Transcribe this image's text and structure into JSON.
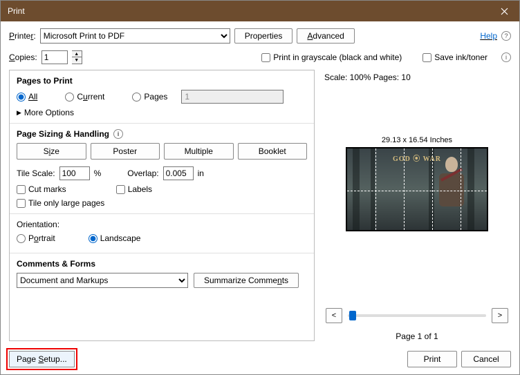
{
  "title": "Print",
  "printer": {
    "label": "Printer:",
    "selected": "Microsoft Print to PDF"
  },
  "buttons": {
    "properties": "Properties",
    "advanced": "Advanced",
    "summarize": "Summarize Comments",
    "page_setup": "Page Setup...",
    "print": "Print",
    "cancel": "Cancel",
    "size": "Size",
    "poster": "Poster",
    "multiple": "Multiple",
    "booklet": "Booklet"
  },
  "help": "Help",
  "copies": {
    "label": "Copies:",
    "value": "1"
  },
  "grayscale": "Print in grayscale (black and white)",
  "save_ink": "Save ink/toner",
  "pages_to_print": {
    "title": "Pages to Print",
    "all": "All",
    "current": "Current",
    "pages": "Pages",
    "pages_value": "1",
    "more": "More Options"
  },
  "sizing": {
    "title": "Page Sizing & Handling",
    "tile_scale_label": "Tile Scale:",
    "tile_scale": "100",
    "percent": "%",
    "overlap_label": "Overlap:",
    "overlap": "0.005",
    "unit": "in",
    "cut_marks": "Cut marks",
    "labels": "Labels",
    "tile_only": "Tile only large pages"
  },
  "orientation": {
    "title": "Orientation:",
    "portrait": "Portrait",
    "landscape": "Landscape"
  },
  "comments": {
    "title": "Comments & Forms",
    "selected": "Document and Markups"
  },
  "preview": {
    "scale_info": "Scale: 100% Pages: 10",
    "dimensions": "29.13 x 16.54 Inches",
    "logo": "GOD ⦿ WAR",
    "page_of": "Page 1 of 1"
  }
}
